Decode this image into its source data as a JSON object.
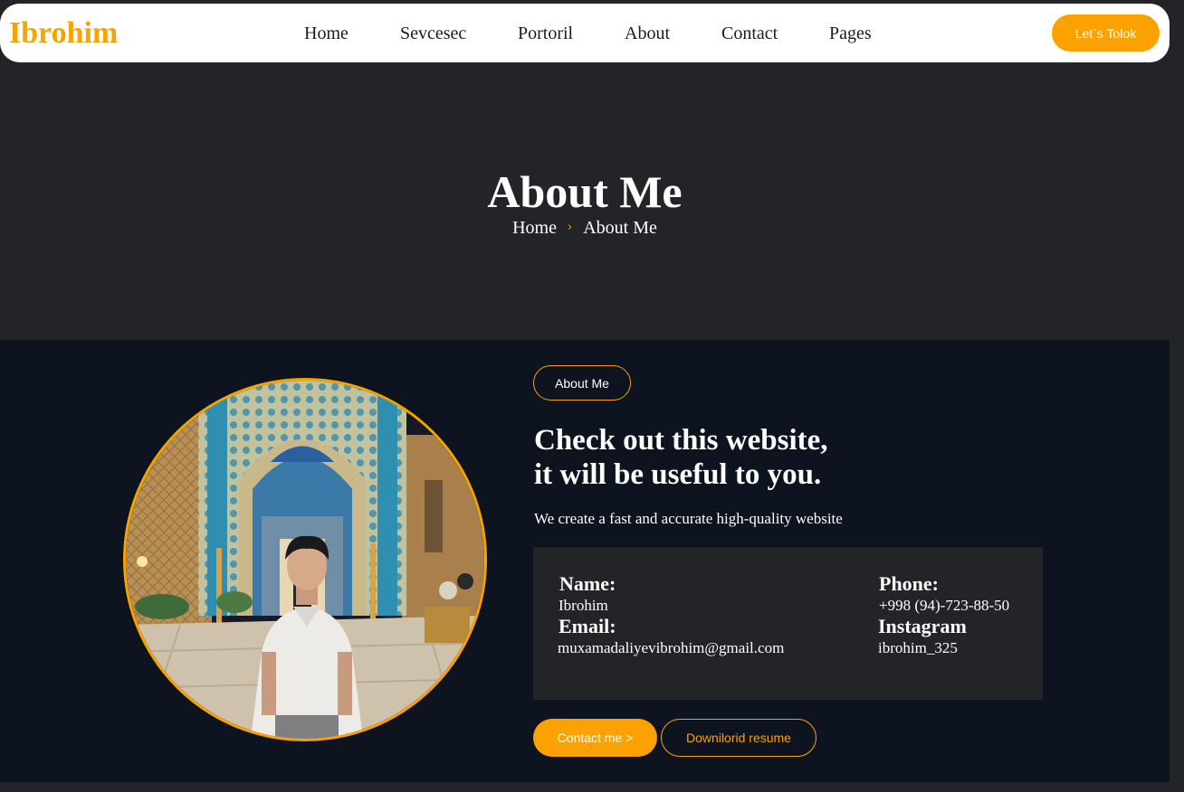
{
  "nav": {
    "logo": "Ibrohim",
    "links": [
      "Home",
      "Sevcesec",
      "Portoril",
      "About",
      "Contact",
      "Pages"
    ],
    "cta": "Let`s Tolok"
  },
  "hero": {
    "title": "About Me",
    "breadcrumb": {
      "home": "Home",
      "separator": "›",
      "current": "About Me"
    }
  },
  "about": {
    "tag": "About Me",
    "heading": [
      "Check out this website,",
      "it will be useful to you."
    ],
    "subtitle": "We create a fast and accurate high-quality website",
    "info": {
      "name_label": "Name:",
      "name_value": "Ibrohim",
      "email_label": "Email:",
      "email_value": "muxamadaliyevibrohim@gmail.com",
      "phone_label": "Phone:",
      "phone_value": "+998 (94)-723-88-50",
      "instagram_label": "Instagram",
      "instagram_value": "ibrohim_325"
    },
    "buttons": {
      "contact": "Contact me >",
      "resume": "Downilorid resume"
    }
  },
  "colors": {
    "accent": "#fba200",
    "page_bg": "#222427",
    "section_bg": "#0e1320",
    "nav_bg": "#ffffff"
  }
}
